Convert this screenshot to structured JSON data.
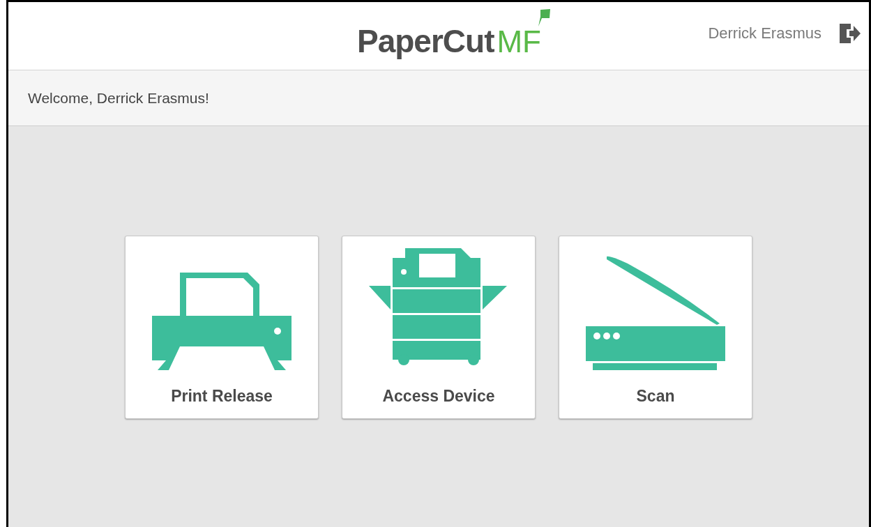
{
  "header": {
    "logo": {
      "name": "PaperCut",
      "suffix": "MF"
    },
    "user_name": "Derrick Erasmus"
  },
  "welcome": "Welcome, Derrick Erasmus!",
  "tiles": [
    {
      "kind": "printer",
      "label": "Print Release"
    },
    {
      "kind": "copier",
      "label": "Access Device"
    },
    {
      "kind": "scanner",
      "label": "Scan"
    }
  ]
}
